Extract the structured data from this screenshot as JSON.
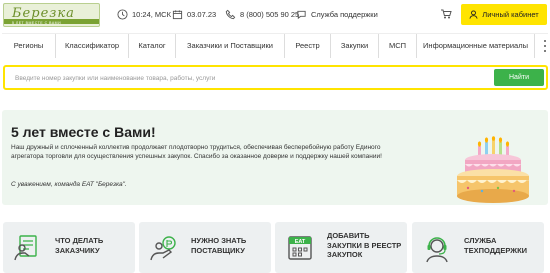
{
  "brand": {
    "logo_text": "Березка",
    "logo_sub": "5 ЛЕТ ВМЕСТЕ С ВАМИ"
  },
  "header": {
    "time": "10:24, МСК",
    "date": "03.07.23",
    "phone": "8 (800) 505 90 25",
    "support": "Служба поддержки",
    "cabinet": "Личный кабинет"
  },
  "nav": {
    "items": [
      "Регионы",
      "Классификатор",
      "Каталог",
      "Заказчики и Поставщики",
      "Реестр",
      "Закупки",
      "МСП",
      "Информационные материалы"
    ]
  },
  "search": {
    "placeholder": "Введите номер закупки или наименование товара, работы, услуги",
    "button": "Найти"
  },
  "banner": {
    "title": "5 лет вместе с Вами!",
    "text": "Наш дружный и сплоченный коллектив продолжает плодотворно трудиться, обеспечивая бесперебойную работу Единого агрегатора торговли для осуществления успешных закупок. Спасибо за оказанное доверие и поддержку нашей компании!",
    "signature": "С уважением, команда ЕАТ \"Березка\"."
  },
  "cards": [
    {
      "line1": "ЧТО ДЕЛАТЬ",
      "line2": "ЗАКАЗЧИКУ",
      "line3": "",
      "icon": "customer-manual-icon"
    },
    {
      "line1": "НУЖНО ЗНАТЬ",
      "line2": "ПОСТАВЩИКУ",
      "line3": "",
      "icon": "supplier-coins-icon"
    },
    {
      "line1": "ДОБАВИТЬ",
      "line2": "ЗАКУПКИ В РЕЕСТР",
      "line3": "ЗАКУПОК",
      "icon": "eat-calendar-icon"
    },
    {
      "line1": "СЛУЖБА",
      "line2": "ТЕХПОДДЕРЖКИ",
      "line3": "",
      "icon": "support-headset-icon"
    }
  ],
  "colors": {
    "accent_yellow": "#ffe400",
    "search_green": "#3cb24a",
    "banner_bg": "#eef6ef",
    "card_bg": "#edf0f1",
    "logo_green": "#7aa232"
  }
}
